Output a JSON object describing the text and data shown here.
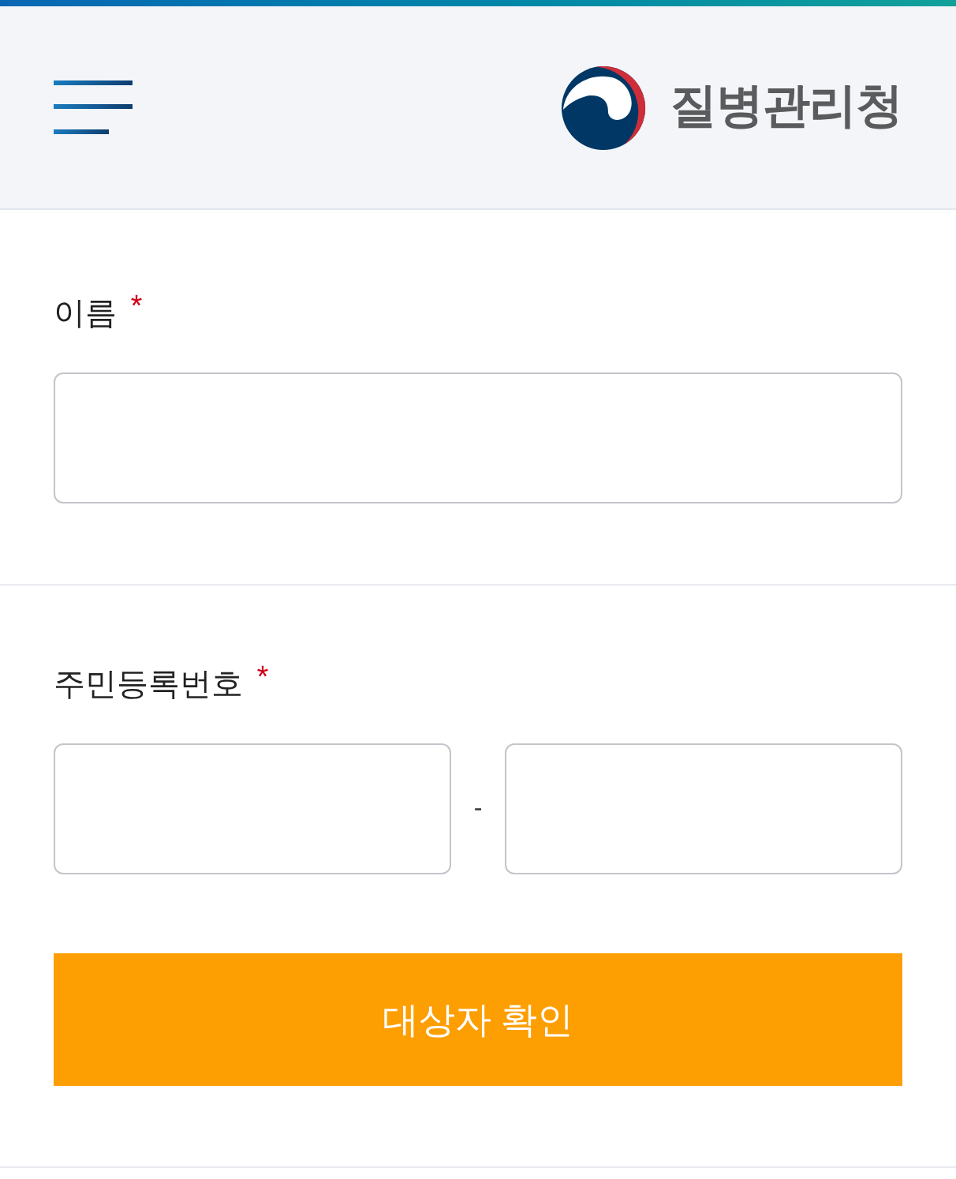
{
  "header": {
    "logo": {
      "text": "질병관리청"
    }
  },
  "fields": [
    {
      "kind": "single",
      "label": "이름",
      "required": true,
      "required_mark": "*"
    },
    {
      "kind": "split",
      "label": "주민등록번호",
      "required": true,
      "required_mark": "*",
      "separator": "-"
    }
  ],
  "submit_button": {
    "label": "대상자 확인"
  }
}
